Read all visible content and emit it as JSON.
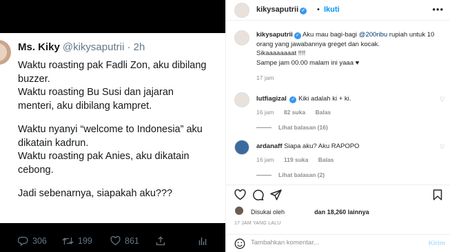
{
  "tweet": {
    "name": "Ms. Kiky",
    "handle": "@kikysaputrii · 2h",
    "lines": [
      "Waktu roasting pak Fadli Zon, aku dibilang",
      "buzzer.",
      "Waktu roasting Bu Susi dan jajaran",
      "menteri, aku dibilang kampret.",
      "",
      "Waktu nyanyi “welcome to Indonesia” aku",
      "dikatain kadrun.",
      "Waktu roasting pak Anies, aku dikatain",
      "cebong.",
      "",
      "Jadi sebenarnya, siapakah aku???"
    ],
    "reply_count": "306",
    "retweet_count": "199",
    "like_count": "861"
  },
  "header": {
    "username": "kikysaputrii",
    "dot": "•",
    "follow_label": "Ikuti",
    "more_glyph": "•••"
  },
  "caption": {
    "username": "kikysaputrii",
    "text_before_mention": "Aku mau bagi-bagi",
    "mention": "@200ribu",
    "text_after_mention": "rupiah untuk 10 orang yang jawabannya greget dan kocak.",
    "line2": "Sikaaaaaaaat !!!!",
    "line3": "Sampe jam 00.00 malam ini yaaa ♥",
    "time": "17 jam"
  },
  "comments": [
    {
      "username": "lutfiagizal",
      "text": "Kiki adalah ki + ki.",
      "time": "16 jam",
      "likes": "82 suka",
      "reply": "Balas",
      "replies": "Lihat balasan (16)"
    },
    {
      "username": "ardanaff",
      "text": "Siapa aku? Aku RAPOPO",
      "time": "16 jam",
      "likes": "119 suka",
      "reply": "Balas",
      "replies": "Lihat balasan (2)"
    }
  ],
  "likes": {
    "prefix": "Disukai oleh",
    "suffix": "dan 18,260 lainnya"
  },
  "post_time": "17 JAM YANG LALU",
  "add_comment": {
    "placeholder": "Tambahkan komentar...",
    "post_label": "Kirim"
  },
  "colors": {
    "accent": "#0095f6",
    "verified": "#3897f0",
    "muted": "#8e8e8e",
    "media_bg": "#000000"
  }
}
